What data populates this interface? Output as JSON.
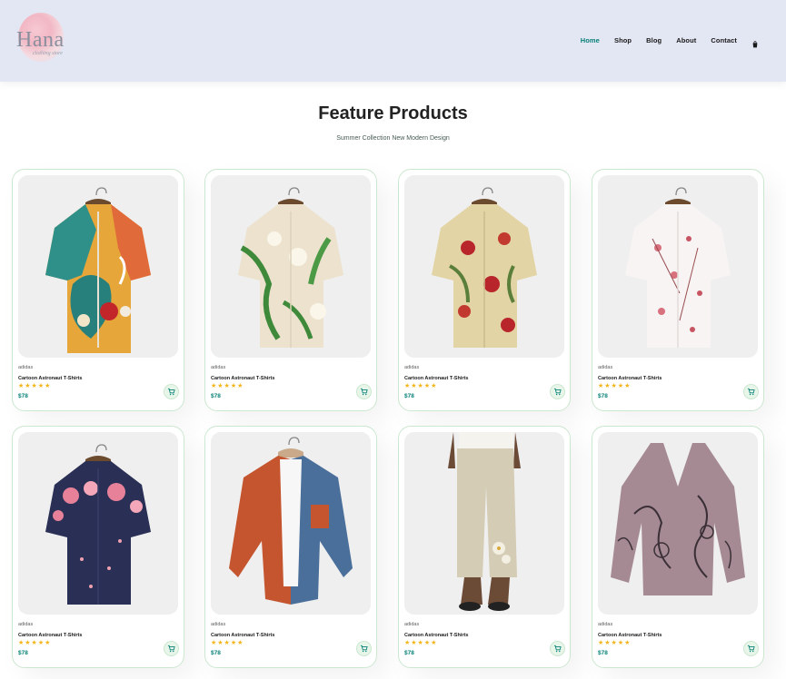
{
  "brand": {
    "logo_text": "Hana",
    "logo_sub": "clothing store"
  },
  "nav": {
    "items": [
      {
        "label": "Home",
        "active": true
      },
      {
        "label": "Shop",
        "active": false
      },
      {
        "label": "Blog",
        "active": false
      },
      {
        "label": "About",
        "active": false
      },
      {
        "label": "Contact",
        "active": false
      }
    ],
    "cart_icon": "shopping-bag-icon"
  },
  "section": {
    "title": "Feature Products",
    "subtitle": "Summer Collection New Modern Design"
  },
  "colors": {
    "accent": "#088178",
    "header_bg": "#e3e6f3",
    "star": "#f3b519",
    "card_border": "#cce7d0"
  },
  "products": [
    {
      "brand": "adidas",
      "name": "Cartoon Astronaut T-Shirts",
      "stars": "★★★★★",
      "price": "$78",
      "image": "shirt-abstract-pattern"
    },
    {
      "brand": "adidas",
      "name": "Cartoon Astronaut T-Shirts",
      "stars": "★★★★★",
      "price": "$78",
      "image": "shirt-white-floral-leaves"
    },
    {
      "brand": "adidas",
      "name": "Cartoon Astronaut T-Shirts",
      "stars": "★★★★★",
      "price": "$78",
      "image": "shirt-beige-red-floral"
    },
    {
      "brand": "adidas",
      "name": "Cartoon Astronaut T-Shirts",
      "stars": "★★★★★",
      "price": "$78",
      "image": "shirt-white-pink-blossom"
    },
    {
      "brand": "adidas",
      "name": "Cartoon Astronaut T-Shirts",
      "stars": "★★★★★",
      "price": "$78",
      "image": "shirt-navy-pink-roses"
    },
    {
      "brand": "adidas",
      "name": "Cartoon Astronaut T-Shirts",
      "stars": "★★★★★",
      "price": "$78",
      "image": "shirt-orange-blue-denim"
    },
    {
      "brand": "adidas",
      "name": "Cartoon Astronaut T-Shirts",
      "stars": "★★★★★",
      "price": "$78",
      "image": "linen-trousers-beige"
    },
    {
      "brand": "adidas",
      "name": "Cartoon Astronaut T-Shirts",
      "stars": "★★★★★",
      "price": "$78",
      "image": "blouse-mauve-paisley"
    }
  ]
}
